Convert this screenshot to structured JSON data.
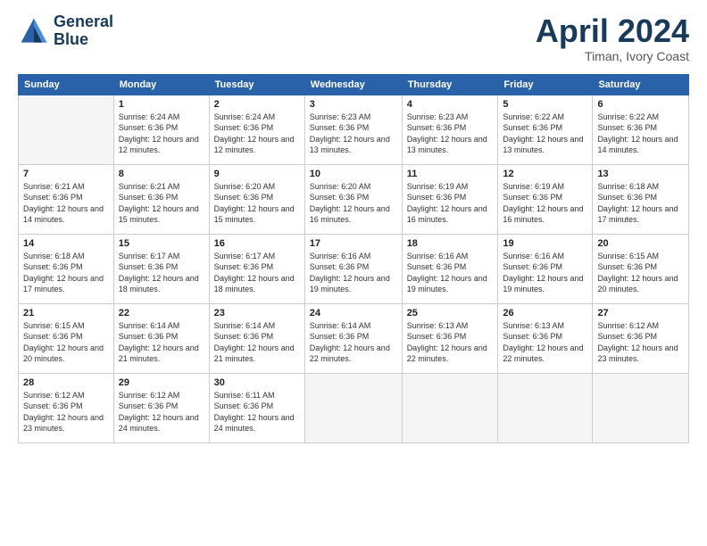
{
  "logo": {
    "line1": "General",
    "line2": "Blue"
  },
  "title": "April 2024",
  "location": "Timan, Ivory Coast",
  "days_header": [
    "Sunday",
    "Monday",
    "Tuesday",
    "Wednesday",
    "Thursday",
    "Friday",
    "Saturday"
  ],
  "weeks": [
    [
      {
        "num": "",
        "empty": true
      },
      {
        "num": "1",
        "sunrise": "Sunrise: 6:24 AM",
        "sunset": "Sunset: 6:36 PM",
        "daylight": "Daylight: 12 hours and 12 minutes."
      },
      {
        "num": "2",
        "sunrise": "Sunrise: 6:24 AM",
        "sunset": "Sunset: 6:36 PM",
        "daylight": "Daylight: 12 hours and 12 minutes."
      },
      {
        "num": "3",
        "sunrise": "Sunrise: 6:23 AM",
        "sunset": "Sunset: 6:36 PM",
        "daylight": "Daylight: 12 hours and 13 minutes."
      },
      {
        "num": "4",
        "sunrise": "Sunrise: 6:23 AM",
        "sunset": "Sunset: 6:36 PM",
        "daylight": "Daylight: 12 hours and 13 minutes."
      },
      {
        "num": "5",
        "sunrise": "Sunrise: 6:22 AM",
        "sunset": "Sunset: 6:36 PM",
        "daylight": "Daylight: 12 hours and 13 minutes."
      },
      {
        "num": "6",
        "sunrise": "Sunrise: 6:22 AM",
        "sunset": "Sunset: 6:36 PM",
        "daylight": "Daylight: 12 hours and 14 minutes."
      }
    ],
    [
      {
        "num": "7",
        "sunrise": "Sunrise: 6:21 AM",
        "sunset": "Sunset: 6:36 PM",
        "daylight": "Daylight: 12 hours and 14 minutes."
      },
      {
        "num": "8",
        "sunrise": "Sunrise: 6:21 AM",
        "sunset": "Sunset: 6:36 PM",
        "daylight": "Daylight: 12 hours and 15 minutes."
      },
      {
        "num": "9",
        "sunrise": "Sunrise: 6:20 AM",
        "sunset": "Sunset: 6:36 PM",
        "daylight": "Daylight: 12 hours and 15 minutes."
      },
      {
        "num": "10",
        "sunrise": "Sunrise: 6:20 AM",
        "sunset": "Sunset: 6:36 PM",
        "daylight": "Daylight: 12 hours and 16 minutes."
      },
      {
        "num": "11",
        "sunrise": "Sunrise: 6:19 AM",
        "sunset": "Sunset: 6:36 PM",
        "daylight": "Daylight: 12 hours and 16 minutes."
      },
      {
        "num": "12",
        "sunrise": "Sunrise: 6:19 AM",
        "sunset": "Sunset: 6:36 PM",
        "daylight": "Daylight: 12 hours and 16 minutes."
      },
      {
        "num": "13",
        "sunrise": "Sunrise: 6:18 AM",
        "sunset": "Sunset: 6:36 PM",
        "daylight": "Daylight: 12 hours and 17 minutes."
      }
    ],
    [
      {
        "num": "14",
        "sunrise": "Sunrise: 6:18 AM",
        "sunset": "Sunset: 6:36 PM",
        "daylight": "Daylight: 12 hours and 17 minutes."
      },
      {
        "num": "15",
        "sunrise": "Sunrise: 6:17 AM",
        "sunset": "Sunset: 6:36 PM",
        "daylight": "Daylight: 12 hours and 18 minutes."
      },
      {
        "num": "16",
        "sunrise": "Sunrise: 6:17 AM",
        "sunset": "Sunset: 6:36 PM",
        "daylight": "Daylight: 12 hours and 18 minutes."
      },
      {
        "num": "17",
        "sunrise": "Sunrise: 6:16 AM",
        "sunset": "Sunset: 6:36 PM",
        "daylight": "Daylight: 12 hours and 19 minutes."
      },
      {
        "num": "18",
        "sunrise": "Sunrise: 6:16 AM",
        "sunset": "Sunset: 6:36 PM",
        "daylight": "Daylight: 12 hours and 19 minutes."
      },
      {
        "num": "19",
        "sunrise": "Sunrise: 6:16 AM",
        "sunset": "Sunset: 6:36 PM",
        "daylight": "Daylight: 12 hours and 19 minutes."
      },
      {
        "num": "20",
        "sunrise": "Sunrise: 6:15 AM",
        "sunset": "Sunset: 6:36 PM",
        "daylight": "Daylight: 12 hours and 20 minutes."
      }
    ],
    [
      {
        "num": "21",
        "sunrise": "Sunrise: 6:15 AM",
        "sunset": "Sunset: 6:36 PM",
        "daylight": "Daylight: 12 hours and 20 minutes."
      },
      {
        "num": "22",
        "sunrise": "Sunrise: 6:14 AM",
        "sunset": "Sunset: 6:36 PM",
        "daylight": "Daylight: 12 hours and 21 minutes."
      },
      {
        "num": "23",
        "sunrise": "Sunrise: 6:14 AM",
        "sunset": "Sunset: 6:36 PM",
        "daylight": "Daylight: 12 hours and 21 minutes."
      },
      {
        "num": "24",
        "sunrise": "Sunrise: 6:14 AM",
        "sunset": "Sunset: 6:36 PM",
        "daylight": "Daylight: 12 hours and 22 minutes."
      },
      {
        "num": "25",
        "sunrise": "Sunrise: 6:13 AM",
        "sunset": "Sunset: 6:36 PM",
        "daylight": "Daylight: 12 hours and 22 minutes."
      },
      {
        "num": "26",
        "sunrise": "Sunrise: 6:13 AM",
        "sunset": "Sunset: 6:36 PM",
        "daylight": "Daylight: 12 hours and 22 minutes."
      },
      {
        "num": "27",
        "sunrise": "Sunrise: 6:12 AM",
        "sunset": "Sunset: 6:36 PM",
        "daylight": "Daylight: 12 hours and 23 minutes."
      }
    ],
    [
      {
        "num": "28",
        "sunrise": "Sunrise: 6:12 AM",
        "sunset": "Sunset: 6:36 PM",
        "daylight": "Daylight: 12 hours and 23 minutes."
      },
      {
        "num": "29",
        "sunrise": "Sunrise: 6:12 AM",
        "sunset": "Sunset: 6:36 PM",
        "daylight": "Daylight: 12 hours and 24 minutes."
      },
      {
        "num": "30",
        "sunrise": "Sunrise: 6:11 AM",
        "sunset": "Sunset: 6:36 PM",
        "daylight": "Daylight: 12 hours and 24 minutes."
      },
      {
        "num": "",
        "empty": true
      },
      {
        "num": "",
        "empty": true
      },
      {
        "num": "",
        "empty": true
      },
      {
        "num": "",
        "empty": true
      }
    ]
  ]
}
